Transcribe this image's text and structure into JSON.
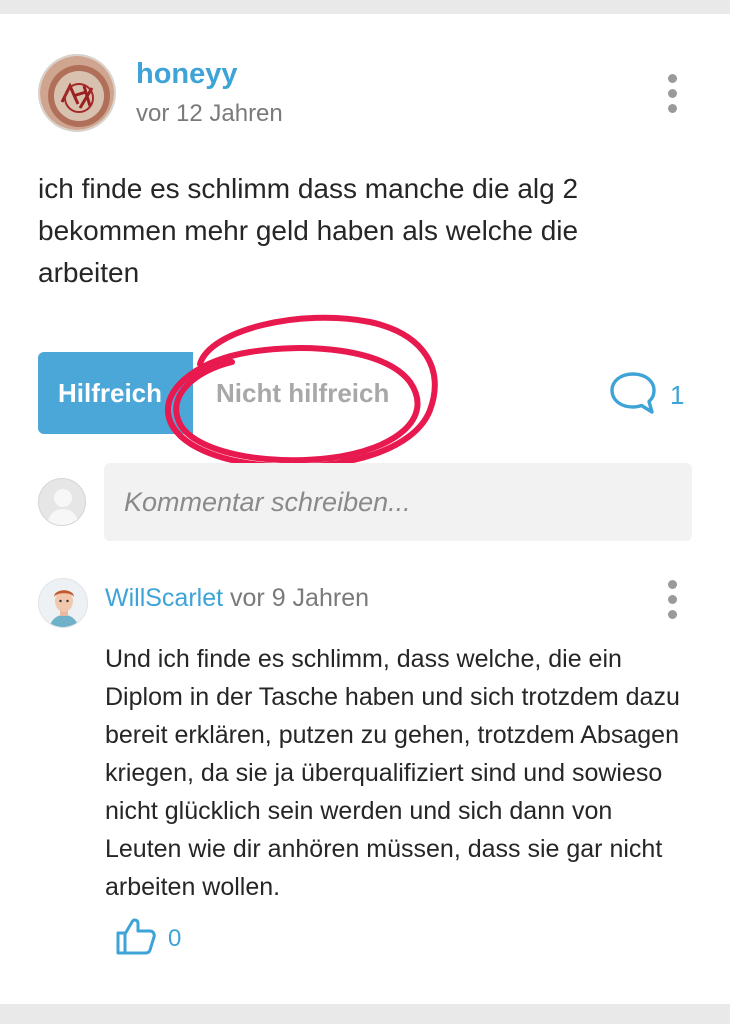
{
  "post": {
    "author": "honeyy",
    "time": "vor 12 Jahren",
    "text": "ich finde es schlimm dass manche die alg 2 bekommen mehr geld haben als welche die arbeiten",
    "helpful_label": "Hilfreich",
    "not_helpful_label": "Nicht hilfreich",
    "comment_count": "1"
  },
  "composer": {
    "placeholder": "Kommentar schreiben..."
  },
  "comment": {
    "author": "WillScarlet",
    "time": "vor 9 Jahren",
    "text": "Und ich finde es schlimm, dass welche, die ein Diplom in der Tasche haben und sich trotzdem dazu bereit erklären, putzen zu gehen, trotzdem Absagen kriegen, da sie ja überqualifiziert sind und sowieso nicht glücklich sein werden und sich dann von Leuten wie dir anhören müssen, dass sie gar nicht arbeiten wollen.",
    "likes": "0"
  },
  "colors": {
    "accent": "#3ea3d6",
    "helpful_button": "#4ba7d8",
    "annotation": "#e8194f"
  },
  "icons": {
    "menu": "more-vertical-icon",
    "comment": "speech-bubble-icon",
    "like": "thumbs-up-icon"
  }
}
